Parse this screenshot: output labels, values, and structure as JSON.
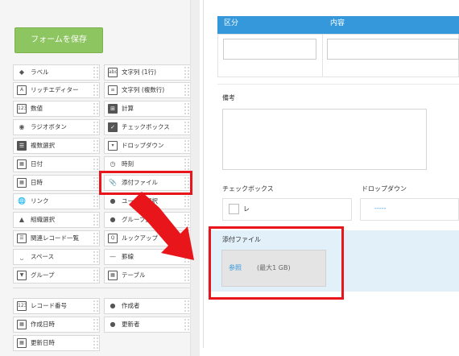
{
  "save_button_label": "フォームを保存",
  "palette": {
    "items": [
      {
        "label": "ラベル",
        "icon": "label-icon"
      },
      {
        "label": "文字列 (1行)",
        "icon": "single-line-text-icon"
      },
      {
        "label": "リッチエディター",
        "icon": "rich-editor-icon"
      },
      {
        "label": "文字列 (複数行)",
        "icon": "multi-line-text-icon"
      },
      {
        "label": "数値",
        "icon": "number-icon"
      },
      {
        "label": "計算",
        "icon": "calculation-icon"
      },
      {
        "label": "ラジオボタン",
        "icon": "radio-button-icon"
      },
      {
        "label": "チェックボックス",
        "icon": "checkbox-icon"
      },
      {
        "label": "複数選択",
        "icon": "multi-select-icon"
      },
      {
        "label": "ドロップダウン",
        "icon": "dropdown-icon"
      },
      {
        "label": "日付",
        "icon": "date-icon"
      },
      {
        "label": "時刻",
        "icon": "clock-icon"
      },
      {
        "label": "日時",
        "icon": "datetime-icon"
      },
      {
        "label": "添付ファイル",
        "icon": "paperclip-icon"
      },
      {
        "label": "リンク",
        "icon": "link-icon"
      },
      {
        "label": "ユーザー選択",
        "icon": "user-icon"
      },
      {
        "label": "組織選択",
        "icon": "organization-icon"
      },
      {
        "label": "グループ選択",
        "icon": "group-icon"
      },
      {
        "label": "関連レコード一覧",
        "icon": "related-records-icon"
      },
      {
        "label": "ルックアップ",
        "icon": "lookup-icon"
      },
      {
        "label": "スペース",
        "icon": "space-icon"
      },
      {
        "label": "罫線",
        "icon": "border-line-icon"
      },
      {
        "label": "グループ",
        "icon": "group-field-icon"
      },
      {
        "label": "テーブル",
        "icon": "table-icon"
      }
    ],
    "system_items": [
      {
        "label": "レコード番号",
        "icon": "record-number-icon"
      },
      {
        "label": "作成者",
        "icon": "creator-icon"
      },
      {
        "label": "作成日時",
        "icon": "created-datetime-icon"
      },
      {
        "label": "更新者",
        "icon": "updater-icon"
      },
      {
        "label": "更新日時",
        "icon": "updated-datetime-icon"
      }
    ]
  },
  "form": {
    "table_headers": [
      "区分",
      "内容"
    ],
    "remarks_label": "備考",
    "checkbox_label": "チェックボックス",
    "checkbox_option": "レ",
    "dropdown_label": "ドロップダウン",
    "dropdown_value": "-----",
    "attachment_label": "添付ファイル",
    "browse_label": "参照",
    "max_size": "(最大1 GB)"
  },
  "colors": {
    "save_button": "#8dc560",
    "table_header": "#3498db",
    "highlight": "#e8151b",
    "attachment_bg": "#e1f0f9"
  }
}
